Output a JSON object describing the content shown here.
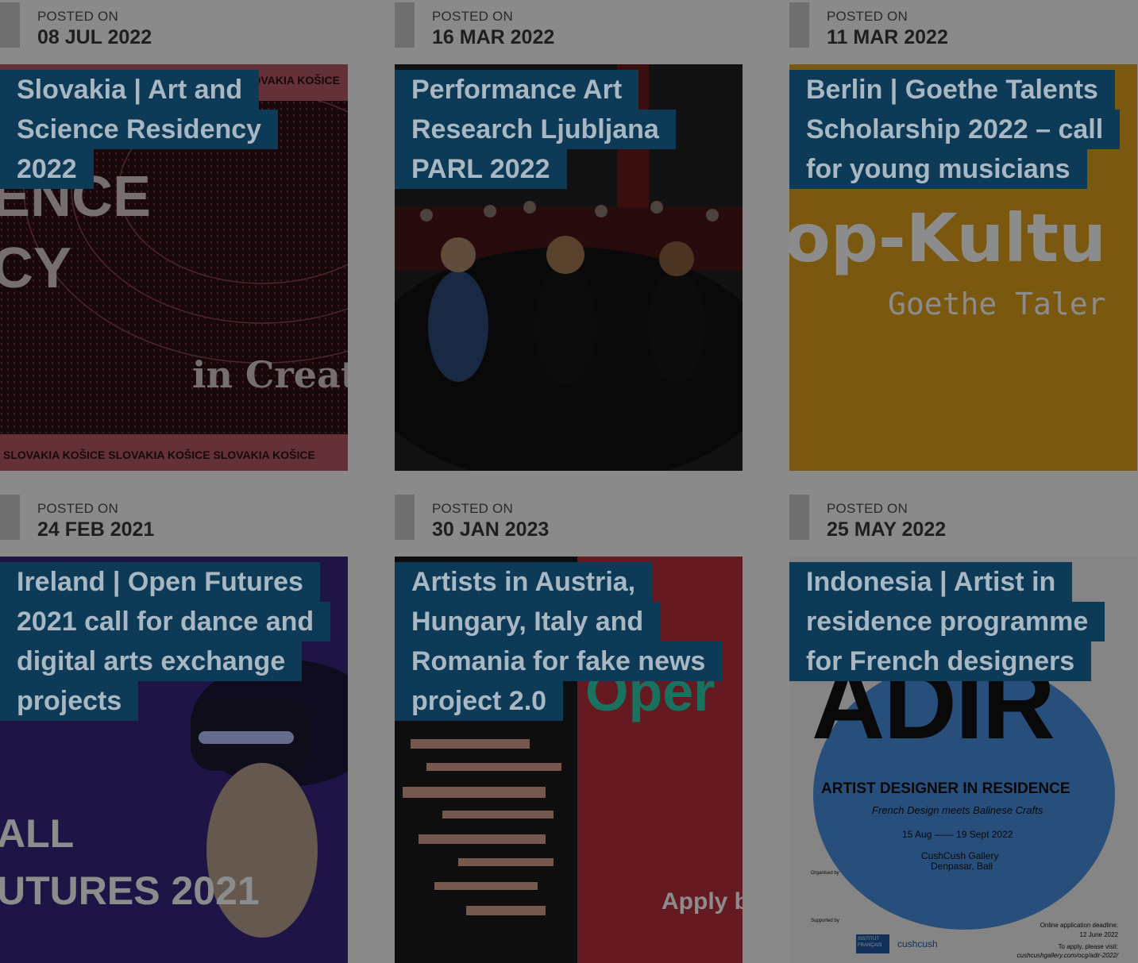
{
  "posts": [
    {
      "label": "POSTED ON",
      "date": "08 JUL 2022",
      "title": "Slovakia | Art and Science Residency 2022",
      "title_lines": [
        "Slovakia | Art and",
        "Science Residency",
        "2022"
      ],
      "thumb": {
        "bg": "#b85a66",
        "inner": "#2b1014",
        "text_big": "ENCE",
        "text_big2": "CY",
        "text_script": "in Creat",
        "footer": "SLOVAKIA  KOŠICE  SLOVAKIA  KOŠICE  SLOVAKIA  KOŠICE",
        "header": "SLOVAKIA  KOŠICE"
      }
    },
    {
      "label": "POSTED ON",
      "date": "16 MAR 2022",
      "title": "Performance Art Research Ljubljana PARL 2022",
      "title_lines": [
        "Performance Art",
        "Research Ljubljana",
        "PARL 2022"
      ],
      "thumb": {
        "bg": "#1a1a1a"
      }
    },
    {
      "label": "POSTED ON",
      "date": "11 MAR 2022",
      "title": "Berlin | Goethe Talents Scholarship 2022 – call for young musicians",
      "title_lines": [
        "Berlin | Goethe Talents",
        "Scholarship 2022 – call",
        "for young musicians"
      ],
      "thumb": {
        "bg": "#c7861a",
        "text_big": "op-Kultu",
        "text_sub": "Goethe Taler"
      }
    },
    {
      "label": "POSTED ON",
      "date": "24 FEB 2021",
      "title": "Ireland | Open Futures 2021 call for dance and digital arts exchange projects",
      "title_lines": [
        "Ireland | Open Futures",
        "2021 call for dance and",
        "digital arts exchange",
        "projects"
      ],
      "thumb": {
        "bg": "#3d2a82",
        "text_big": "ALL",
        "text_big2": "UTURES 2021"
      }
    },
    {
      "label": "POSTED ON",
      "date": "30 JAN 2023",
      "title": "Artists in Austria, Hungary, Italy and Romania for fake news project 2.0",
      "title_lines": [
        "Artists in Austria,",
        "Hungary, Italy and",
        "Romania for fake news",
        "project 2.0"
      ],
      "thumb": {
        "bg": "#b8303e",
        "text_big": "Oper",
        "text_cta": "Apply b"
      }
    },
    {
      "label": "POSTED ON",
      "date": "25 MAY 2022",
      "title": "Indonesia | Artist in residence programme for French designers",
      "title_lines": [
        "Indonesia | Artist in",
        "residence programme",
        "for French designers"
      ],
      "thumb": {
        "bg": "#d9d9d9",
        "text_big": "ADIR",
        "subtitle": "ARTIST DESIGNER IN RESIDENCE",
        "tagline": "French Design meets Balinese Crafts",
        "dates": "15 Aug —— 19 Sept 2022",
        "venue1": "CushCush Gallery",
        "venue2": "Denpasar, Bali",
        "organised": "Organised by",
        "supported": "Supported by",
        "deadline1": "Online application deadline:",
        "deadline2": "12 June 2022",
        "apply1": "To apply, please visit:",
        "apply2": "cushcushgallery.com/ocg/adir-2022/",
        "sponsor": "cushcush",
        "institut": "INSTITUT FRANÇAIS"
      }
    }
  ],
  "colors": {
    "title_bg": "#0d3b57",
    "title_text": "#a9b7c2",
    "page_bg": "#8a8a8a",
    "meta_bar": "#6f6f6f"
  }
}
